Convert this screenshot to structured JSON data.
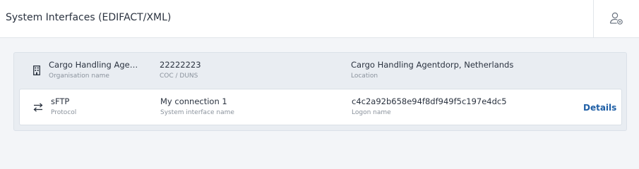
{
  "header": {
    "title": "System Interfaces (EDIFACT/XML)",
    "user_icon": "user-settings-icon"
  },
  "organisation": {
    "icon": "building-icon",
    "name": "Cargo Handling Age…",
    "name_label": "Organisation name",
    "coc": "22222223",
    "coc_label": "COC / DUNS",
    "location": "Cargo Handling Agentdorp, Netherlands",
    "location_label": "Location"
  },
  "connection": {
    "icon": "swap-arrows-icon",
    "protocol": "sFTP",
    "protocol_label": "Protocol",
    "interface_name": "My connection 1",
    "interface_name_label": "System interface name",
    "logon_name": "c4c2a92b658e94f8df949f5c197e4dc5",
    "logon_name_label": "Logon name",
    "details_label": "Details"
  },
  "colors": {
    "background": "#f3f5f8",
    "panel": "#e9edf2",
    "link": "#1f5fa6"
  }
}
